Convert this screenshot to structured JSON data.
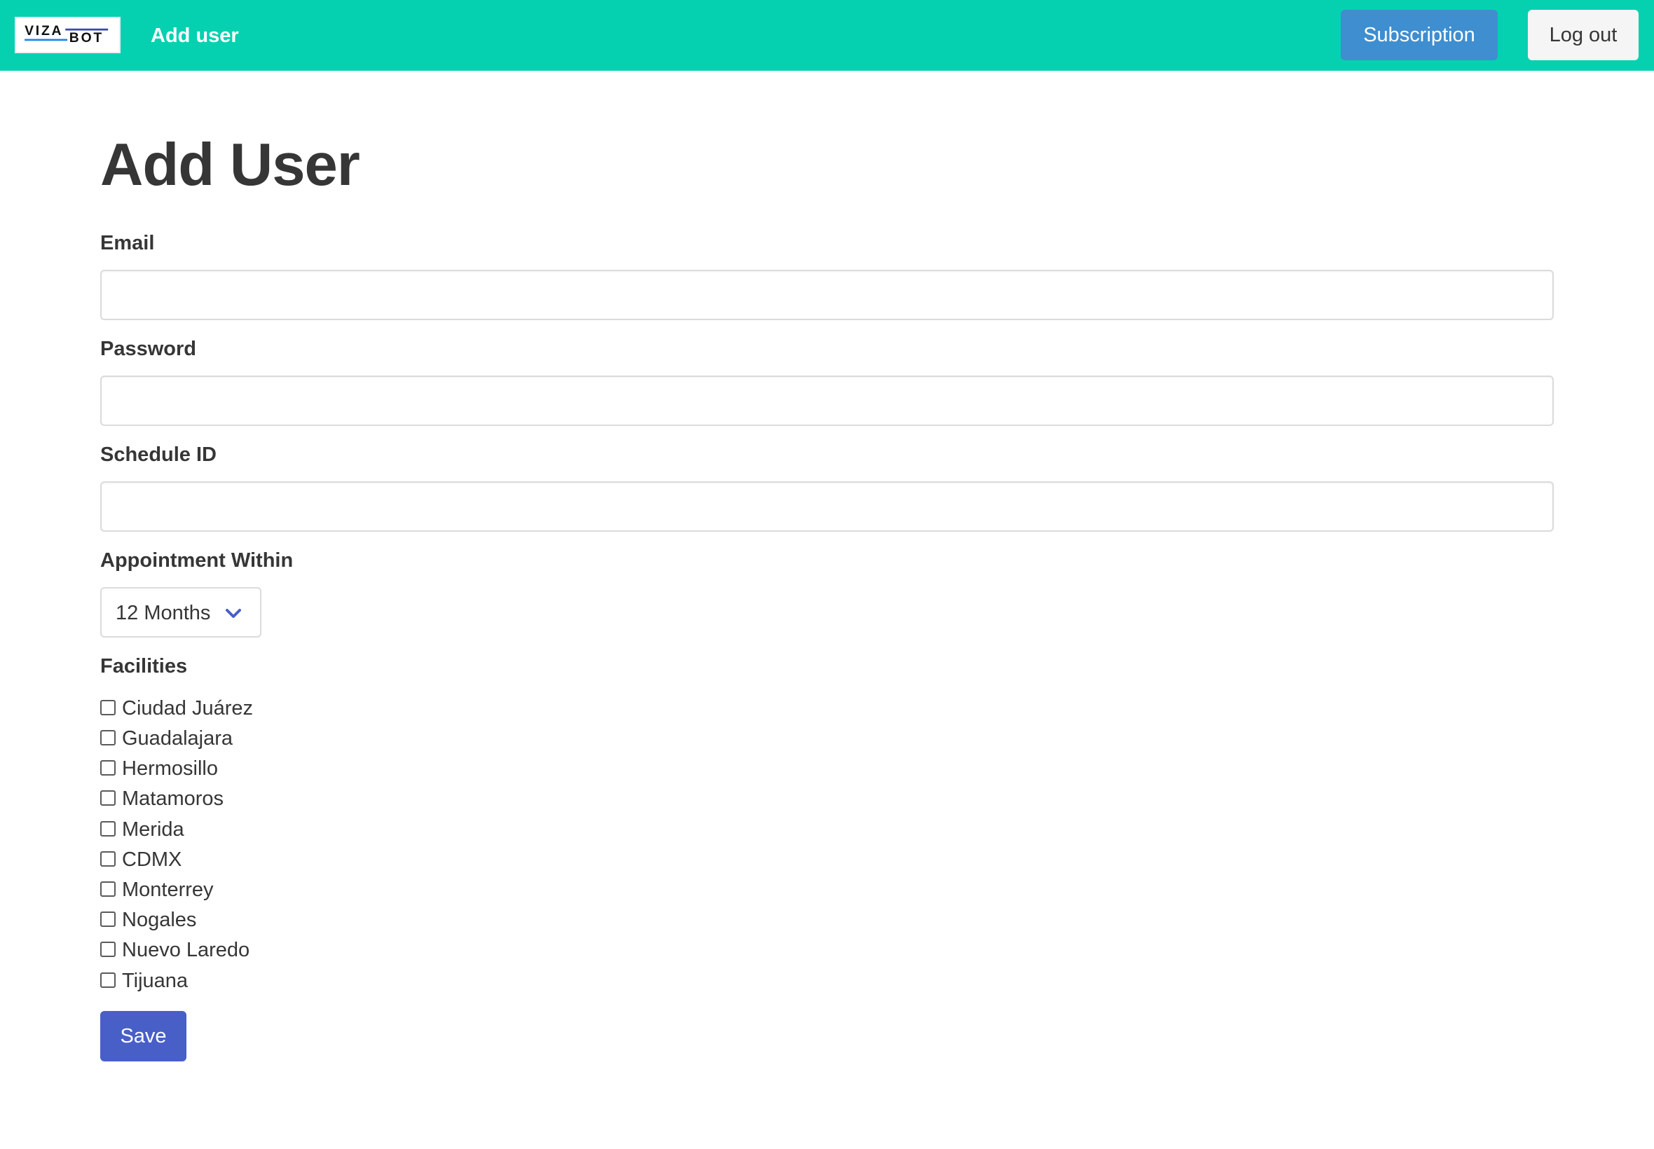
{
  "navbar": {
    "logo": {
      "text_top": "VIZA",
      "text_bottom": "BOT",
      "bar_colors": [
        "#1e88e5",
        "#3949ab"
      ]
    },
    "title": "Add user",
    "subscription_label": "Subscription",
    "logout_label": "Log out",
    "colors": {
      "background": "#05d1b1",
      "subscription_button": "#3e8ed0",
      "logout_button": "#f5f5f5"
    }
  },
  "form": {
    "heading": "Add User",
    "email": {
      "label": "Email",
      "value": "",
      "placeholder": ""
    },
    "password": {
      "label": "Password",
      "value": "",
      "placeholder": ""
    },
    "schedule_id": {
      "label": "Schedule ID",
      "value": "",
      "placeholder": ""
    },
    "appointment_within": {
      "label": "Appointment Within",
      "selected": "12 Months",
      "icon": "chevron-down-icon",
      "icon_color": "#485fc7"
    },
    "facilities": {
      "label": "Facilities",
      "items": [
        {
          "label": "Ciudad Juárez",
          "checked": false
        },
        {
          "label": "Guadalajara",
          "checked": false
        },
        {
          "label": "Hermosillo",
          "checked": false
        },
        {
          "label": "Matamoros",
          "checked": false
        },
        {
          "label": "Merida",
          "checked": false
        },
        {
          "label": "CDMX",
          "checked": false
        },
        {
          "label": "Monterrey",
          "checked": false
        },
        {
          "label": "Nogales",
          "checked": false
        },
        {
          "label": "Nuevo Laredo",
          "checked": false
        },
        {
          "label": "Tijuana",
          "checked": false
        }
      ]
    },
    "save_label": "Save",
    "save_color": "#485fc7"
  }
}
